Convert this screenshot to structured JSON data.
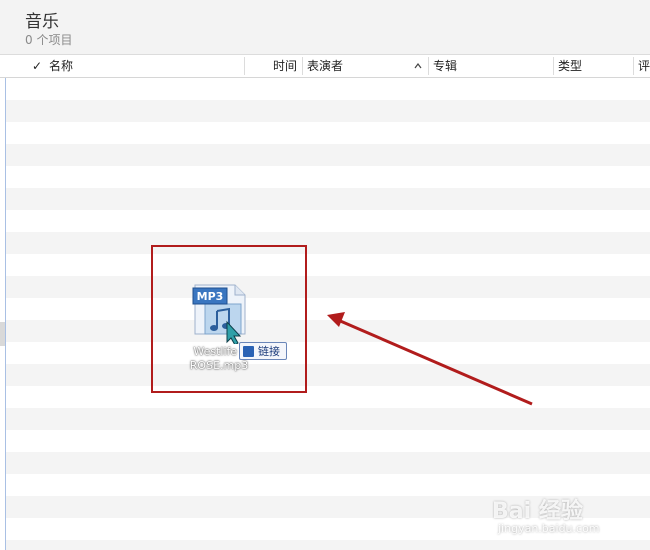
{
  "header": {
    "title": "音乐",
    "subtitle": "0 个项目"
  },
  "columns": {
    "check": "✓",
    "name": "名称",
    "time": "时间",
    "artist": "表演者",
    "sort_indicator": "^",
    "album": "专辑",
    "type": "类型",
    "rating": "评"
  },
  "drag_item": {
    "badge": "MP3",
    "filename_line1": "Westlife -",
    "filename_line2": "ROSE.mp3",
    "tooltip": "链接",
    "icon": "music-file-icon"
  },
  "watermark": {
    "logo": "Bai 经验",
    "url": "jingyan.baidu.com"
  },
  "colors": {
    "annotation_red": "#b11c1c",
    "row_stripe": "#f4f4f4",
    "header_bg": "#f3f3f3"
  }
}
